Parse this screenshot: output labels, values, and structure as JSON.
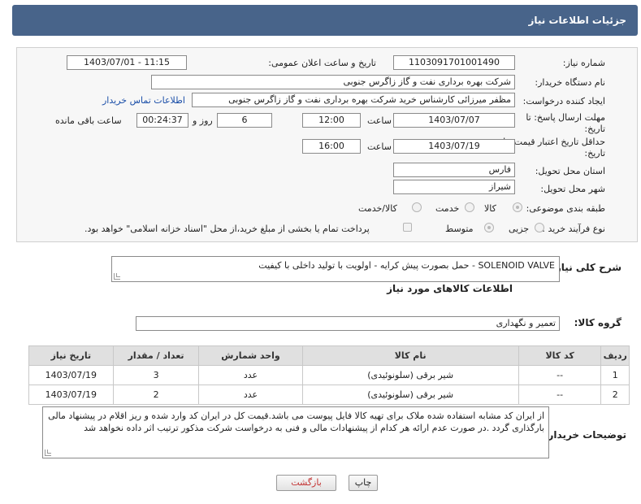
{
  "header": {
    "title": "جزئیات اطلاعات نیاز"
  },
  "form": {
    "need_number_label": "شماره نیاز:",
    "need_number": "1103091701001490",
    "announce_label": "تاریخ و ساعت اعلان عمومی:",
    "announce_value": "1403/07/01 - 11:15",
    "buyer_org_label": "نام دستگاه خریدار:",
    "buyer_org": "شرکت بهره برداری نفت و گاز زاگرس جنوبی",
    "creator_label": "ایجاد کننده درخواست:",
    "creator": "مظفر میرزائی کارشناس خرید شرکت بهره برداری نفت و گاز زاگرس جنوبی",
    "contact_link": "اطلاعات تماس خریدار",
    "deadline_label_1": "مهلت ارسال پاسخ: تا",
    "deadline_label_2": "تاریخ:",
    "deadline_date": "1403/07/07",
    "time_label": "ساعت",
    "deadline_time": "12:00",
    "days_value": "6",
    "days_label": "روز و",
    "remaining_time": "00:24:37",
    "remaining_label": "ساعت باقی مانده",
    "validity_label_1": "حداقل تاریخ اعتبار قیمت: تا",
    "validity_label_2": "تاریخ:",
    "validity_date": "1403/07/19",
    "validity_time": "16:00",
    "province_label": "استان محل تحویل:",
    "province": "فارس",
    "city_label": "شهر محل تحویل:",
    "city": "شیراز",
    "category_label": "طبقه بندی موضوعی:",
    "category_options": [
      "کالا",
      "خدمت",
      "کالا/خدمت"
    ],
    "process_label": "نوع فرآیند خرید :",
    "process_options": [
      "جزیی",
      "متوسط"
    ],
    "payment_note": "پرداخت تمام یا بخشی از مبلغ خرید،از محل \"اسناد خزانه اسلامی\" خواهد بود."
  },
  "description": {
    "label": "شرح کلی نیاز:",
    "text": "SOLENOID VALVE - حمل بصورت پیش کرایه - اولویت با تولید داخلی با کیفیت"
  },
  "goods": {
    "section_title": "اطلاعات کالاهای مورد نیاز",
    "group_label": "گروه کالا:",
    "group_value": "تعمیر و نگهداری",
    "columns": [
      "ردیف",
      "کد کالا",
      "نام کالا",
      "واحد شمارش",
      "تعداد / مقدار",
      "تاریخ نیاز"
    ],
    "rows": [
      [
        "1",
        "--",
        "شیر برقی (سلونوئیدی)",
        "عدد",
        "3",
        "1403/07/19"
      ],
      [
        "2",
        "--",
        "شیر برقی (سلونوئیدی)",
        "عدد",
        "2",
        "1403/07/19"
      ]
    ]
  },
  "buyer_notes": {
    "label": "توضیحات خریدار:",
    "text": "از ایران کد مشابه استفاده شده ملاک برای تهیه کالا فایل پیوست می باشد.قیمت کل در ایران کد وارد شده و ریز اقلام در پیشنهاد مالی بارگذاری گردد .در صورت عدم ارائه هر کدام از پیشنهادات مالی و فنی به درخواست شرکت مذکور ترتیب اثر داده نخواهد شد"
  },
  "buttons": {
    "print": "چاپ",
    "back": "بازگشت"
  },
  "colors": {
    "header_bg": "#48648a",
    "link": "#1a4ea8"
  }
}
